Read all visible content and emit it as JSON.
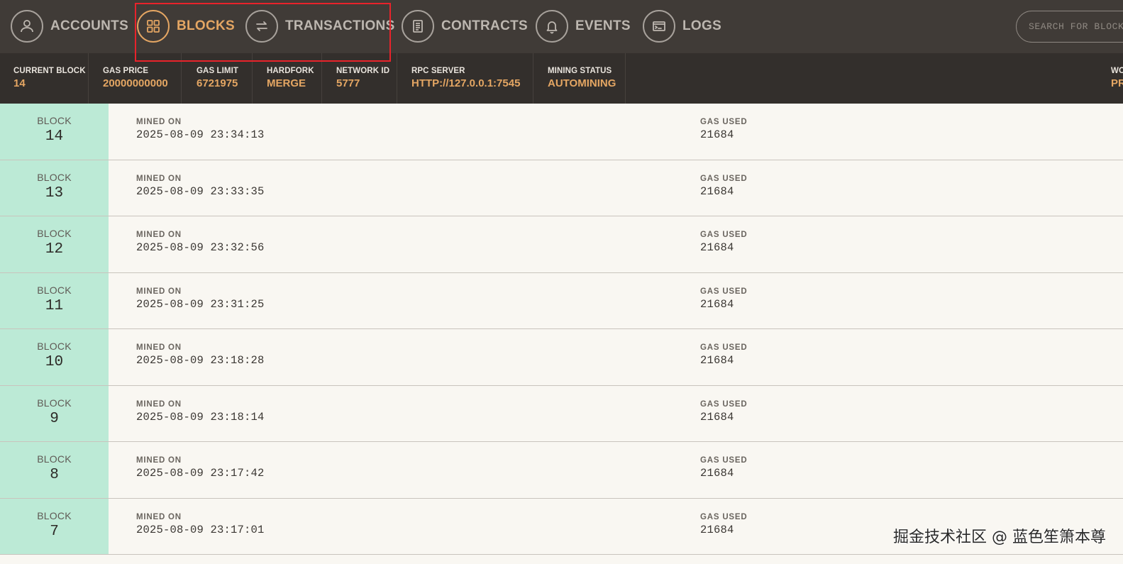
{
  "nav": {
    "items": [
      {
        "label": "ACCOUNTS",
        "icon": "user-icon",
        "active": false
      },
      {
        "label": "BLOCKS",
        "icon": "blocks-grid-icon",
        "active": true
      },
      {
        "label": "TRANSACTIONS",
        "icon": "transfer-arrows-icon",
        "active": false
      },
      {
        "label": "CONTRACTS",
        "icon": "document-icon",
        "active": false
      },
      {
        "label": "EVENTS",
        "icon": "bell-icon",
        "active": false
      },
      {
        "label": "LOGS",
        "icon": "terminal-icon",
        "active": false
      }
    ],
    "search_placeholder": "SEARCH FOR BLOCK NUMBERS OR TX HASHES"
  },
  "status": {
    "current_block": {
      "label": "CURRENT BLOCK",
      "value": "14"
    },
    "gas_price": {
      "label": "GAS PRICE",
      "value": "20000000000"
    },
    "gas_limit": {
      "label": "GAS LIMIT",
      "value": "6721975"
    },
    "hardfork": {
      "label": "HARDFORK",
      "value": "MERGE"
    },
    "network_id": {
      "label": "NETWORK ID",
      "value": "5777"
    },
    "rpc_server": {
      "label": "RPC SERVER",
      "value": "HTTP://127.0.0.1:7545"
    },
    "mining_status": {
      "label": "MINING STATUS",
      "value": "AUTOMINING"
    },
    "workspace": {
      "label": "WO",
      "value": "PR"
    }
  },
  "blocks": [
    {
      "label": "BLOCK",
      "number": "14",
      "mined_label": "MINED ON",
      "mined_on": "2025-08-09 23:34:13",
      "gas_label": "GAS USED",
      "gas_used": "21684"
    },
    {
      "label": "BLOCK",
      "number": "13",
      "mined_label": "MINED ON",
      "mined_on": "2025-08-09 23:33:35",
      "gas_label": "GAS USED",
      "gas_used": "21684"
    },
    {
      "label": "BLOCK",
      "number": "12",
      "mined_label": "MINED ON",
      "mined_on": "2025-08-09 23:32:56",
      "gas_label": "GAS USED",
      "gas_used": "21684"
    },
    {
      "label": "BLOCK",
      "number": "11",
      "mined_label": "MINED ON",
      "mined_on": "2025-08-09 23:31:25",
      "gas_label": "GAS USED",
      "gas_used": "21684"
    },
    {
      "label": "BLOCK",
      "number": "10",
      "mined_label": "MINED ON",
      "mined_on": "2025-08-09 23:18:28",
      "gas_label": "GAS USED",
      "gas_used": "21684"
    },
    {
      "label": "BLOCK",
      "number": "9",
      "mined_label": "MINED ON",
      "mined_on": "2025-08-09 23:18:14",
      "gas_label": "GAS USED",
      "gas_used": "21684"
    },
    {
      "label": "BLOCK",
      "number": "8",
      "mined_label": "MINED ON",
      "mined_on": "2025-08-09 23:17:42",
      "gas_label": "GAS USED",
      "gas_used": "21684"
    },
    {
      "label": "BLOCK",
      "number": "7",
      "mined_label": "MINED ON",
      "mined_on": "2025-08-09 23:17:01",
      "gas_label": "GAS USED",
      "gas_used": "21684"
    }
  ],
  "watermark": "掘金技术社区 @ 蓝色笙箫本尊",
  "colors": {
    "nav_bg": "#403b37",
    "status_bg": "#332f2c",
    "accent": "#e4a663",
    "block_cell": "#bcead6",
    "highlight": "#e8232b"
  }
}
